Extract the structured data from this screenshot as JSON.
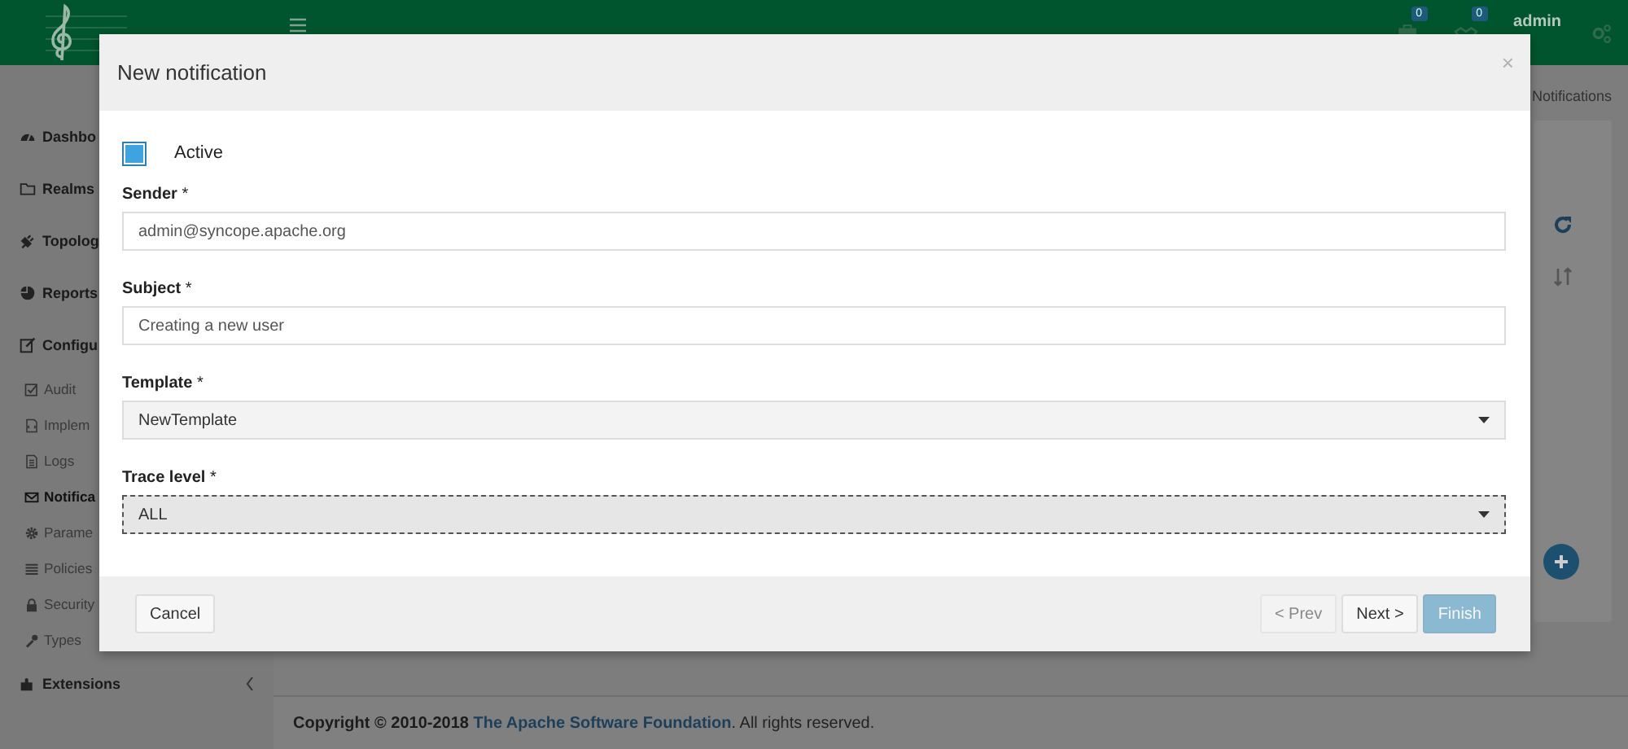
{
  "topbar": {
    "badges": [
      {
        "count": "0"
      },
      {
        "count": "0"
      }
    ],
    "user": "admin"
  },
  "sidebar": {
    "items": [
      {
        "label": "Dashbo"
      },
      {
        "label": "Realms"
      },
      {
        "label": "Topolog"
      },
      {
        "label": "Reports"
      },
      {
        "label": "Configu",
        "children": [
          {
            "label": "Audit",
            "selected": false
          },
          {
            "label": "Implem",
            "selected": false
          },
          {
            "label": "Logs",
            "selected": false
          },
          {
            "label": "Notifica",
            "selected": true
          },
          {
            "label": "Parame",
            "selected": false
          },
          {
            "label": "Policies",
            "selected": false
          },
          {
            "label": "Security",
            "selected": false
          },
          {
            "label": "Types",
            "selected": false
          }
        ]
      },
      {
        "label": "Extensions",
        "expanded": false
      }
    ]
  },
  "breadcrumb": "Notifications",
  "modal": {
    "title": "New notification",
    "close": "×",
    "active": {
      "label": "Active",
      "checked": true
    },
    "fields": [
      {
        "kind": "text",
        "label": "Sender",
        "required_mark": "*",
        "value": "admin@syncope.apache.org"
      },
      {
        "kind": "text",
        "label": "Subject",
        "required_mark": "*",
        "value": "Creating a new user"
      },
      {
        "kind": "select",
        "label": "Template",
        "required_mark": "*",
        "value": "NewTemplate",
        "focused": false
      },
      {
        "kind": "select",
        "label": "Trace level",
        "required_mark": "*",
        "value": "ALL",
        "focused": true
      }
    ],
    "cancel": {
      "label": "Cancel"
    },
    "nav_buttons": [
      {
        "label": "< Prev",
        "kind": "default",
        "disabled": true
      },
      {
        "label": "Next >",
        "kind": "default",
        "disabled": false
      },
      {
        "label": "Finish",
        "kind": "primary",
        "disabled": true
      }
    ]
  },
  "footer": {
    "copyright": "Copyright © 2010-2018",
    "link": "The Apache Software Foundation",
    "rest": ". All rights reserved."
  }
}
